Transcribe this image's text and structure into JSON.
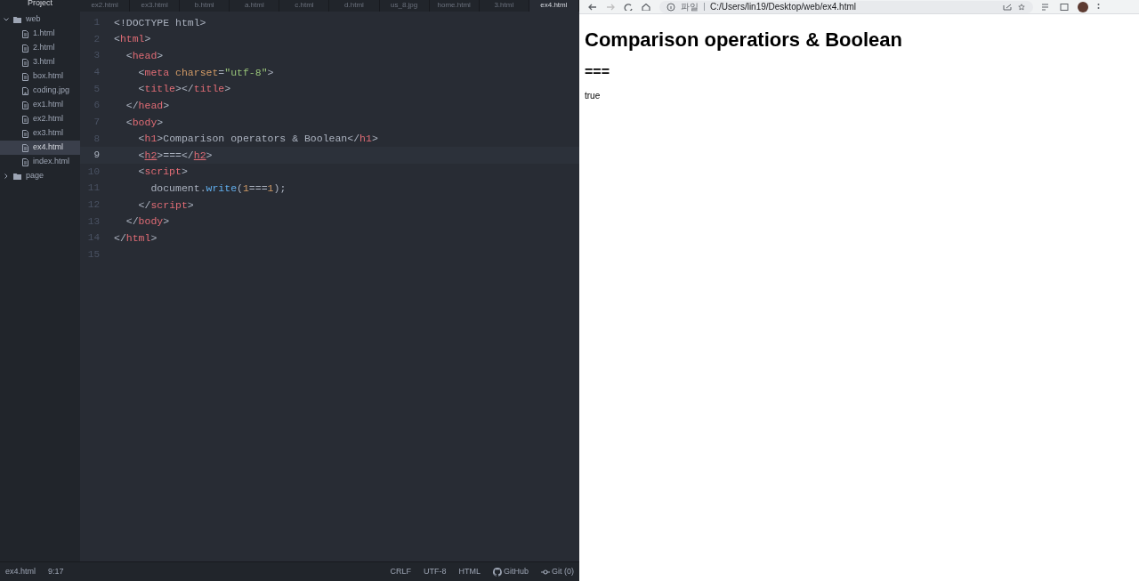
{
  "sidebar": {
    "title": "Project",
    "tree": [
      {
        "name": "web",
        "kind": "folder",
        "expanded": true,
        "children": [
          {
            "name": "1.html",
            "kind": "file",
            "selected": false
          },
          {
            "name": "2.html",
            "kind": "file",
            "selected": false
          },
          {
            "name": "3.html",
            "kind": "file",
            "selected": false
          },
          {
            "name": "box.html",
            "kind": "file",
            "selected": false
          },
          {
            "name": "coding.jpg",
            "kind": "image",
            "selected": false
          },
          {
            "name": "ex1.html",
            "kind": "file",
            "selected": false
          },
          {
            "name": "ex2.html",
            "kind": "file",
            "selected": false
          },
          {
            "name": "ex3.html",
            "kind": "file",
            "selected": false
          },
          {
            "name": "ex4.html",
            "kind": "file",
            "selected": true
          },
          {
            "name": "index.html",
            "kind": "file",
            "selected": false
          }
        ]
      },
      {
        "name": "page",
        "kind": "folder",
        "expanded": false
      }
    ]
  },
  "tabs": [
    {
      "label": "ex2.html",
      "selected": false
    },
    {
      "label": "ex3.html",
      "selected": false
    },
    {
      "label": "b.html",
      "selected": false
    },
    {
      "label": "a.html",
      "selected": false
    },
    {
      "label": "c.html",
      "selected": false
    },
    {
      "label": "d.html",
      "selected": false
    },
    {
      "label": "us_8.jpg",
      "selected": false
    },
    {
      "label": "home.html",
      "selected": false
    },
    {
      "label": "3.html",
      "selected": false
    },
    {
      "label": "ex4.html",
      "selected": true
    }
  ],
  "code": [
    {
      "number": "1",
      "current": false,
      "tokens": [
        {
          "kind": "text",
          "text": "<!DOCTYPE html>"
        }
      ]
    },
    {
      "number": "2",
      "current": false,
      "tokens": [
        {
          "kind": "punct",
          "text": "<"
        },
        {
          "kind": "tag",
          "text": "html"
        },
        {
          "kind": "punct",
          "text": ">"
        }
      ]
    },
    {
      "number": "3",
      "current": false,
      "tokens": [
        {
          "kind": "punct",
          "text": "  <"
        },
        {
          "kind": "tag",
          "text": "head"
        },
        {
          "kind": "punct",
          "text": ">"
        }
      ]
    },
    {
      "number": "4",
      "current": false,
      "tokens": [
        {
          "kind": "punct",
          "text": "    <"
        },
        {
          "kind": "tag",
          "text": "meta"
        },
        {
          "kind": "attr",
          "text": " charset"
        },
        {
          "kind": "punct",
          "text": "="
        },
        {
          "kind": "string",
          "text": "\"utf-8\""
        },
        {
          "kind": "punct",
          "text": ">"
        }
      ]
    },
    {
      "number": "5",
      "current": false,
      "tokens": [
        {
          "kind": "punct",
          "text": "    <"
        },
        {
          "kind": "tag",
          "text": "title"
        },
        {
          "kind": "punct",
          "text": "></"
        },
        {
          "kind": "tag",
          "text": "title"
        },
        {
          "kind": "punct",
          "text": ">"
        }
      ]
    },
    {
      "number": "6",
      "current": false,
      "tokens": [
        {
          "kind": "punct",
          "text": "  </"
        },
        {
          "kind": "tag",
          "text": "head"
        },
        {
          "kind": "punct",
          "text": ">"
        }
      ]
    },
    {
      "number": "7",
      "current": false,
      "tokens": [
        {
          "kind": "punct",
          "text": "  <"
        },
        {
          "kind": "tag",
          "text": "body"
        },
        {
          "kind": "punct",
          "text": ">"
        }
      ]
    },
    {
      "number": "8",
      "current": false,
      "tokens": [
        {
          "kind": "punct",
          "text": "    <"
        },
        {
          "kind": "tag",
          "text": "h1"
        },
        {
          "kind": "punct",
          "text": ">"
        },
        {
          "kind": "text",
          "text": "Comparison operators & Boolean"
        },
        {
          "kind": "punct",
          "text": "</"
        },
        {
          "kind": "tag",
          "text": "h1"
        },
        {
          "kind": "punct",
          "text": ">"
        }
      ]
    },
    {
      "number": "9",
      "current": true,
      "tokens": [
        {
          "kind": "punct",
          "text": "    <"
        },
        {
          "kind": "match",
          "text": "h2"
        },
        {
          "kind": "punct",
          "text": ">"
        },
        {
          "kind": "text",
          "text": "==="
        },
        {
          "kind": "punct",
          "text": "</"
        },
        {
          "kind": "match",
          "text": "h2"
        },
        {
          "kind": "punct",
          "text": ">"
        }
      ]
    },
    {
      "number": "10",
      "current": false,
      "tokens": [
        {
          "kind": "punct",
          "text": "    <"
        },
        {
          "kind": "tag",
          "text": "script"
        },
        {
          "kind": "punct",
          "text": ">"
        }
      ]
    },
    {
      "number": "11",
      "current": false,
      "tokens": [
        {
          "kind": "text",
          "text": "      document"
        },
        {
          "kind": "punct",
          "text": "."
        },
        {
          "kind": "func",
          "text": "write"
        },
        {
          "kind": "punct",
          "text": "("
        },
        {
          "kind": "number",
          "text": "1"
        },
        {
          "kind": "text",
          "text": "==="
        },
        {
          "kind": "number",
          "text": "1"
        },
        {
          "kind": "punct",
          "text": ");"
        }
      ]
    },
    {
      "number": "12",
      "current": false,
      "tokens": [
        {
          "kind": "punct",
          "text": "    </"
        },
        {
          "kind": "tag",
          "text": "script"
        },
        {
          "kind": "punct",
          "text": ">"
        }
      ]
    },
    {
      "number": "13",
      "current": false,
      "tokens": [
        {
          "kind": "punct",
          "text": "  </"
        },
        {
          "kind": "tag",
          "text": "body"
        },
        {
          "kind": "punct",
          "text": ">"
        }
      ]
    },
    {
      "number": "14",
      "current": false,
      "tokens": [
        {
          "kind": "punct",
          "text": "</"
        },
        {
          "kind": "tag",
          "text": "html"
        },
        {
          "kind": "punct",
          "text": ">"
        }
      ]
    },
    {
      "number": "15",
      "current": false
    }
  ],
  "status_bar": {
    "file": "ex4.html",
    "cursor": "9:17",
    "line_ending": "CRLF",
    "encoding": "UTF-8",
    "grammar": "HTML",
    "github": "GitHub",
    "git": "Git (0)"
  },
  "browser": {
    "scheme_label": "파일",
    "url": "C:/Users/lin19/Desktop/web/ex4.html",
    "heading": "Comparison operatiors & Boolean",
    "subheading": "===",
    "output": "true"
  }
}
